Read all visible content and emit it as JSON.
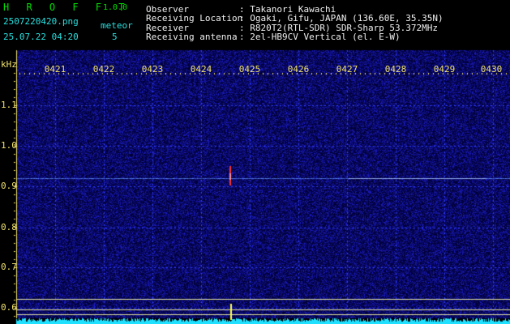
{
  "app": {
    "title": "H R O F F T",
    "version": "1.0.0"
  },
  "file": {
    "name": "2507220420.png",
    "datetime": "25.07.22 04:20"
  },
  "counter": {
    "label": "meteor",
    "value": "5"
  },
  "info": {
    "rows": [
      {
        "label": "Observer",
        "value": ": Takanori Kawachi"
      },
      {
        "label": "Receiving Location",
        "value": ": Ogaki, Gifu, JAPAN (136.60E, 35.35N)"
      },
      {
        "label": "Receiver",
        "value": ": R820T2(RTL-SDR) SDR-Sharp 53.372MHz"
      },
      {
        "label": "Receiving antenna",
        "value": ": 2el-HB9CV Vertical (el. E-W)"
      }
    ]
  },
  "spectrogram": {
    "unit_label": "kHz",
    "time_ticks": [
      "0421",
      "0422",
      "0423",
      "0424",
      "0425",
      "0426",
      "0427",
      "0428",
      "0429",
      "0430"
    ],
    "freq_ticks": [
      "1.1",
      "1.0",
      "0.9",
      "0.8",
      "0.7",
      "0.6"
    ],
    "colors": {
      "background": "#000033",
      "noise": "#2020a0",
      "grid": "#3040ff",
      "tick": "#f2e36a",
      "carrier": "#6090ff",
      "meteor": "#ff3030",
      "reference_lines": "#e8e8a0",
      "baseline": "#20e0ff"
    },
    "meteor_time": "04:24.8",
    "carrier_khz": 0.92
  }
}
